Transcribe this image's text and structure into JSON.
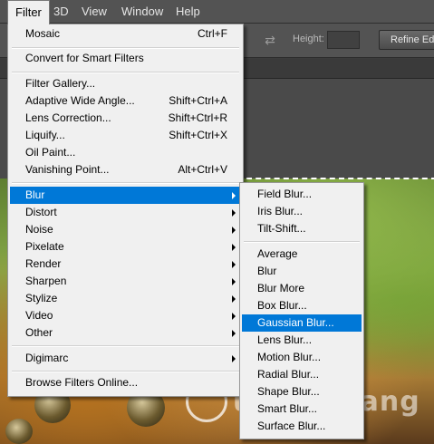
{
  "menubar": {
    "items": [
      {
        "label": "Filter",
        "active": true
      },
      {
        "label": "3D"
      },
      {
        "label": "View"
      },
      {
        "label": "Window"
      },
      {
        "label": "Help"
      }
    ]
  },
  "options_bar": {
    "height_label": "Height:",
    "refine_edge_label": "Refine Edge"
  },
  "watermark": {
    "text": "uantrimang"
  },
  "filter_menu": {
    "items": [
      {
        "label": "Mosaic",
        "shortcut": "Ctrl+F"
      },
      {
        "label": "Convert for Smart Filters"
      },
      {
        "label": "Filter Gallery..."
      },
      {
        "label": "Adaptive Wide Angle...",
        "shortcut": "Shift+Ctrl+A"
      },
      {
        "label": "Lens Correction...",
        "shortcut": "Shift+Ctrl+R"
      },
      {
        "label": "Liquify...",
        "shortcut": "Shift+Ctrl+X"
      },
      {
        "label": "Oil Paint..."
      },
      {
        "label": "Vanishing Point...",
        "shortcut": "Alt+Ctrl+V"
      },
      {
        "label": "Blur",
        "submenu": true,
        "highlighted": true
      },
      {
        "label": "Distort",
        "submenu": true
      },
      {
        "label": "Noise",
        "submenu": true
      },
      {
        "label": "Pixelate",
        "submenu": true
      },
      {
        "label": "Render",
        "submenu": true
      },
      {
        "label": "Sharpen",
        "submenu": true
      },
      {
        "label": "Stylize",
        "submenu": true
      },
      {
        "label": "Video",
        "submenu": true
      },
      {
        "label": "Other",
        "submenu": true
      },
      {
        "label": "Digimarc",
        "submenu": true
      },
      {
        "label": "Browse Filters Online..."
      }
    ]
  },
  "blur_submenu": {
    "items": [
      {
        "label": "Field Blur..."
      },
      {
        "label": "Iris Blur..."
      },
      {
        "label": "Tilt-Shift..."
      },
      {
        "label": "Average"
      },
      {
        "label": "Blur"
      },
      {
        "label": "Blur More"
      },
      {
        "label": "Box Blur..."
      },
      {
        "label": "Gaussian Blur...",
        "highlighted": true
      },
      {
        "label": "Lens Blur..."
      },
      {
        "label": "Motion Blur..."
      },
      {
        "label": "Radial Blur..."
      },
      {
        "label": "Shape Blur..."
      },
      {
        "label": "Smart Blur..."
      },
      {
        "label": "Surface Blur..."
      }
    ]
  },
  "colors": {
    "highlight": "#0078d7",
    "menu_background": "#f0f0f0",
    "app_chrome": "#535353"
  },
  "icons": {
    "swap": "swap-arrows-icon",
    "submenu": "submenu-arrow-icon"
  }
}
